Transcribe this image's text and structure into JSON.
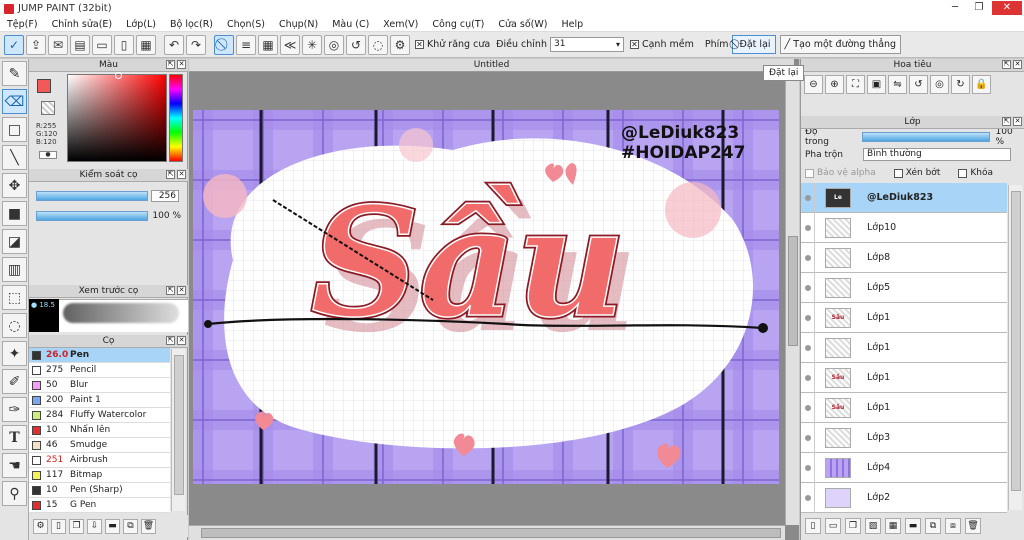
{
  "app": {
    "title": "JUMP PAINT (32bit)"
  },
  "menu": [
    "Tệp(F)",
    "Chỉnh sửa(E)",
    "Lớp(L)",
    "Bộ lọc(R)",
    "Chọn(S)",
    "Chụp(N)",
    "Màu (C)",
    "Xem(V)",
    "Công cụ(T)",
    "Cửa số(W)",
    "Help"
  ],
  "toolbar": {
    "antialias_label": "Khử răng cưa",
    "adjust_label": "Điều chỉnh",
    "adjust_value": "31",
    "soft_edge_label": "Cạnh mềm",
    "key_label": "Phím",
    "reset_label": "Đặt lại",
    "straight_line_label": "Tạo một đường thẳng",
    "tooltip": "Đặt lại"
  },
  "color_panel": {
    "title": "Màu",
    "foreground": "#f25a5a",
    "r": "R:255",
    "g": "G:120",
    "b": "B:120"
  },
  "brush_control": {
    "title": "Kiểm soát cọ",
    "size": "256",
    "opacity": "100 %"
  },
  "brush_preview": {
    "title": "Xem trước cọ",
    "size_readout": "18.5"
  },
  "brush_list": {
    "title": "Cọ",
    "items": [
      {
        "size": "26.0",
        "name": "Pen",
        "color": "#333333",
        "selected": true
      },
      {
        "size": "275",
        "name": "Pencil",
        "color": "#ffffff"
      },
      {
        "size": "50",
        "name": "Blur",
        "color": "#f59ef5"
      },
      {
        "size": "200",
        "name": "Paint 1",
        "color": "#7aa6f5"
      },
      {
        "size": "284",
        "name": "Fluffy Watercolor",
        "color": "#c8f07a"
      },
      {
        "size": "10",
        "name": "Nhấn lên",
        "color": "#e23030"
      },
      {
        "size": "46",
        "name": "Smudge",
        "color": "#f3e0c8"
      },
      {
        "size": "251",
        "name": "Airbrush",
        "color": "#ffffff"
      },
      {
        "size": "117",
        "name": "Bitmap",
        "color": "#f2f25a"
      },
      {
        "size": "10",
        "name": "Pen (Sharp)",
        "color": "#333333"
      },
      {
        "size": "15",
        "name": "G Pen",
        "color": "#e23030"
      }
    ]
  },
  "canvas": {
    "tab_title": "Untitled",
    "handle1": "@LeDiuk823",
    "handle2": "#HOIDAP247",
    "word": "Sầu"
  },
  "navigator": {
    "title": "Hoa tiêu"
  },
  "layers_panel": {
    "title": "Lớp",
    "opacity_label": "Độ trong",
    "opacity_value": "100 %",
    "blend_label": "Pha trộn",
    "blend_value": "Bình thường",
    "protect_alpha": "Bảo vệ alpha",
    "clipping": "Xén bớt",
    "lock": "Khóa",
    "layers": [
      {
        "name": "@LeDiuk823",
        "selected": true,
        "thumb": "Le"
      },
      {
        "name": "Lớp10",
        "thumb": ""
      },
      {
        "name": "Lớp8",
        "thumb": ""
      },
      {
        "name": "Lớp5",
        "thumb": ""
      },
      {
        "name": "Lớp1",
        "thumb": "Sầu"
      },
      {
        "name": "Lớp1",
        "thumb": ""
      },
      {
        "name": "Lớp1",
        "thumb": "Sầu"
      },
      {
        "name": "Lớp1",
        "thumb": "Sầu"
      },
      {
        "name": "Lớp3",
        "thumb": ""
      },
      {
        "name": "Lớp4",
        "thumb": ""
      },
      {
        "name": "Lớp2",
        "thumb": ""
      }
    ]
  }
}
